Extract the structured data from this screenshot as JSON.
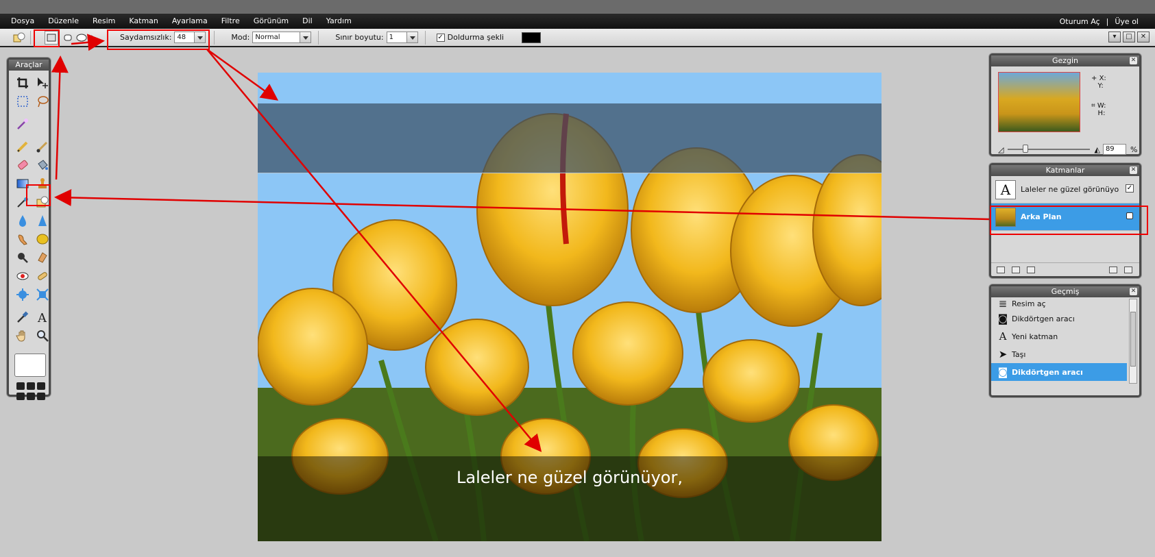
{
  "menu": {
    "items": [
      "Dosya",
      "Düzenle",
      "Resim",
      "Katman",
      "Ayarlama",
      "Filtre",
      "Görünüm",
      "Dil",
      "Yardım"
    ],
    "login": "Oturum Aç",
    "separator": "|",
    "signup": "Üye ol"
  },
  "options": {
    "opacity_label": "Saydamsızlık:",
    "opacity_value": "48",
    "mode_label": "Mod:",
    "mode_value": "Normal",
    "border_label": "Sınır boyutu:",
    "border_value": "1",
    "fill_checked": true,
    "fill_label": "Doldurma şekli",
    "fill_color": "#000000"
  },
  "tools": {
    "title": "Araçlar",
    "items": [
      "crop-tool",
      "move-tool",
      "marquee-tool",
      "lasso-tool",
      "magic-wand-tool",
      "pencil-tool",
      "brush-tool",
      "eraser-tool",
      "paint-bucket-tool",
      "gradient-tool",
      "clone-stamp-tool",
      "color-replace-tool",
      "shape-tool",
      "blur-tool",
      "sharpen-tool",
      "smudge-tool",
      "sponge-tool",
      "dodge-tool",
      "burn-tool",
      "red-eye-tool",
      "spot-heal-tool",
      "bloat-tool",
      "pinch-tool",
      "color-picker-tool",
      "type-tool",
      "hand-tool",
      "zoom-tool"
    ]
  },
  "canvas": {
    "caption": "Laleler ne güzel görünüyor,"
  },
  "navigator": {
    "title": "Gezgin",
    "x_label": "X:",
    "y_label": "Y:",
    "w_label": "W:",
    "h_label": "H:",
    "zoom_value": "89",
    "zoom_unit": "%"
  },
  "layers": {
    "title": "Katmanlar",
    "items": [
      {
        "name": "Laleler ne güzel görünüyo",
        "type": "text",
        "visible": true
      },
      {
        "name": "Arka Plan",
        "type": "image",
        "locked": true
      }
    ]
  },
  "history": {
    "title": "Geçmiş",
    "items": [
      "Resim aç",
      "Dikdörtgen aracı",
      "Yeni katman",
      "Taşı",
      "Dikdörtgen aracı"
    ],
    "selected_index": 4
  },
  "colors": {
    "accent": "#3c9ce6",
    "annotation": "#e00000"
  }
}
